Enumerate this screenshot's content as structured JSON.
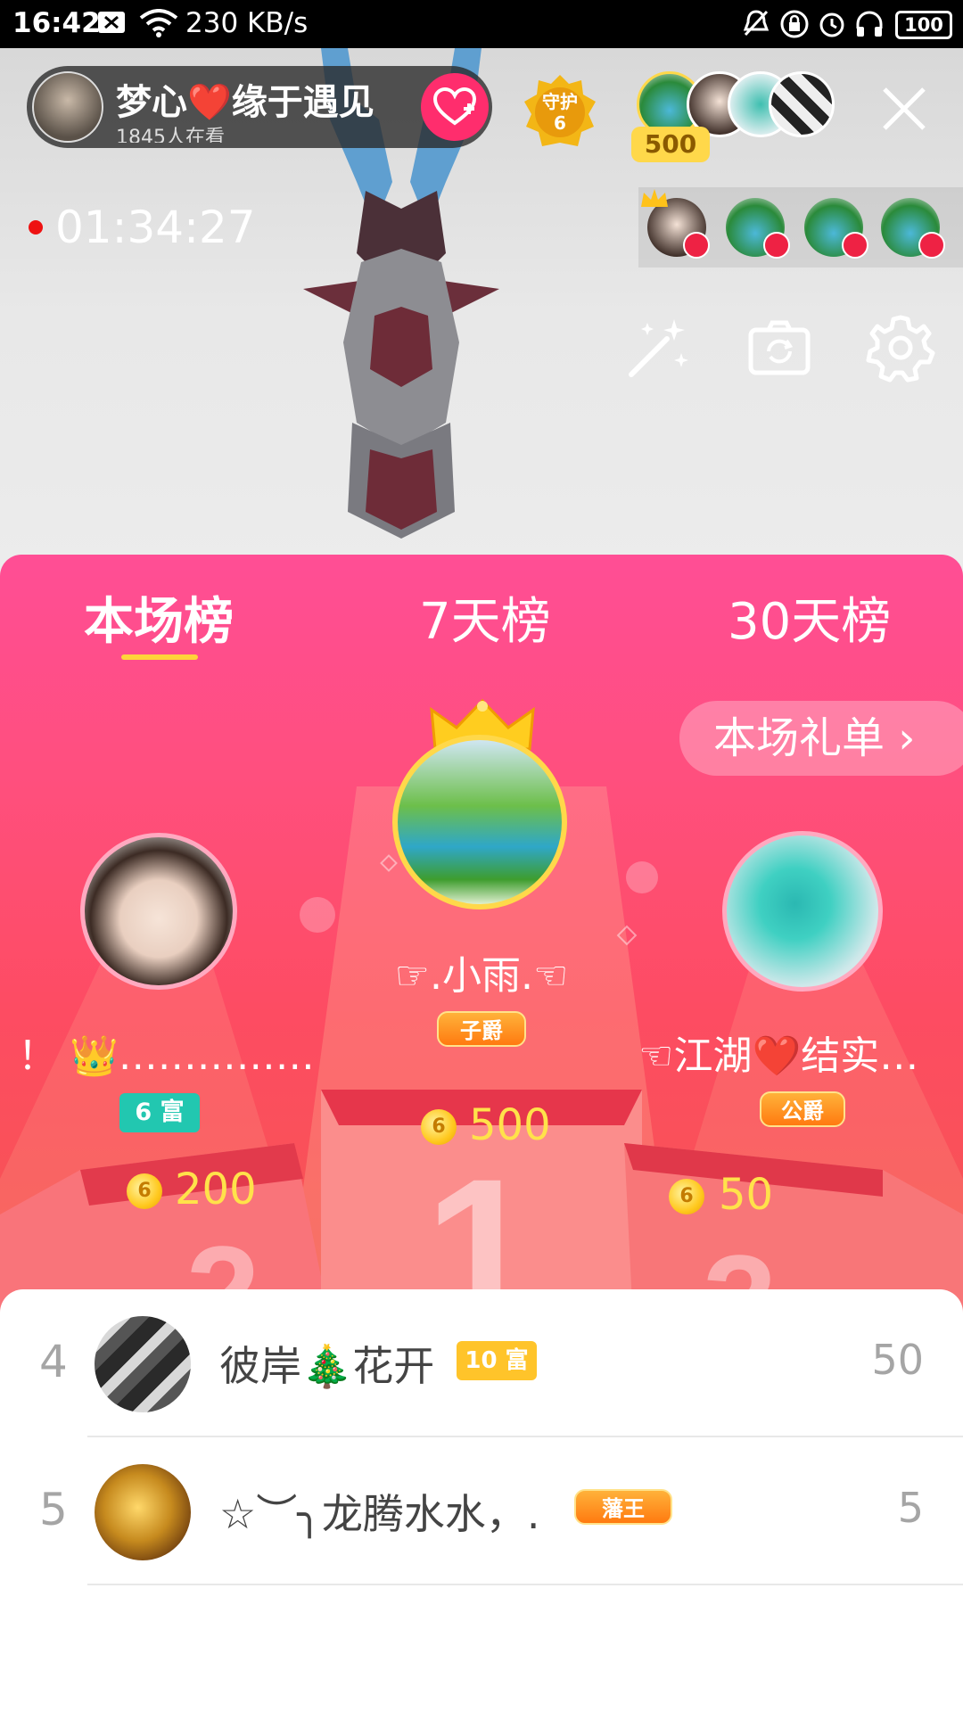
{
  "status_bar": {
    "time": "16:42",
    "net_speed": "230 KB/s",
    "battery": "100",
    "icons": [
      "image-icon",
      "wifi-icon",
      "mute-icon",
      "lock-rotation-icon",
      "alarm-icon",
      "headphones-icon",
      "battery-icon"
    ]
  },
  "host": {
    "name": "梦心❤️缘于遇见",
    "viewers": "1845人在看",
    "follow_icon": "heart-plus-icon"
  },
  "guard": {
    "label": "守护",
    "count": "6"
  },
  "top_viewers": {
    "count": "500"
  },
  "live": {
    "elapsed": "01:34:27"
  },
  "tools": [
    "magic-wand-icon",
    "flip-camera-icon",
    "settings-icon"
  ],
  "tabs": [
    {
      "label": "本场榜",
      "active": true
    },
    {
      "label": "7天榜",
      "active": false
    },
    {
      "label": "30天榜",
      "active": false
    }
  ],
  "gift_list_button": "本场礼单 ›",
  "podium": {
    "first": {
      "name": "☞.小雨.☜",
      "badge": "子爵",
      "amount": "500",
      "coin": "6"
    },
    "second": {
      "name": "！ 👑……………",
      "wealth": "6 富",
      "amount": "200",
      "coin": "6"
    },
    "third": {
      "name": "☜江湖❤️结实…",
      "badge": "公爵",
      "amount": "50",
      "coin": "6"
    }
  },
  "list": [
    {
      "rank": "4",
      "name": "彼岸🎄花开",
      "badge": "10 富",
      "value": "50"
    },
    {
      "rank": "5",
      "name": "☆︶╮龙腾水水，.",
      "badge": "藩王",
      "value": "5"
    }
  ],
  "colors": {
    "panel_top": "#ff4e95",
    "panel_bottom": "#f5564f",
    "accent_gold": "#ffd43a",
    "amount": "#ffe24a",
    "wealth_badge": "#22c7b0"
  }
}
